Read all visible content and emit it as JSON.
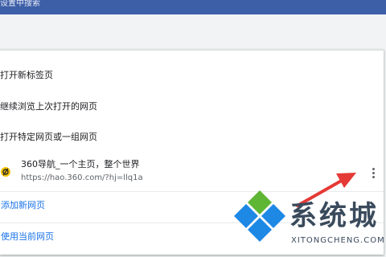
{
  "header": {
    "search_text": "设置中搜索"
  },
  "startup": {
    "options": [
      {
        "label": "打开新标签页"
      },
      {
        "label": "继续浏览上次打开的网页"
      },
      {
        "label": "打开特定网页或一组网页"
      }
    ],
    "site": {
      "name": "360导航_一个主页，整个世界",
      "url": "https://hao.360.com/?hj=llq1a"
    },
    "add_page": "添加新网页",
    "use_current": "使用当前网页"
  },
  "watermark": {
    "text": "系统城",
    "sub": "XITONGCHENG.COM"
  },
  "colors": {
    "header": "#3d5fa8",
    "link": "#1a73e8",
    "arrow": "#e53935"
  }
}
